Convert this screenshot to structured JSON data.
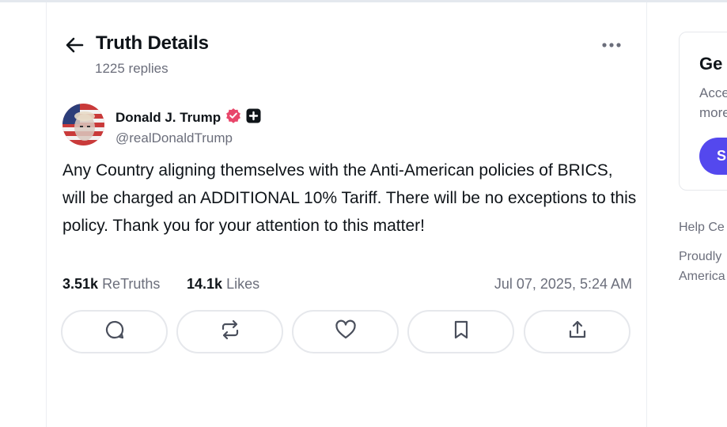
{
  "header": {
    "title": "Truth Details",
    "reply_count": "1225 replies"
  },
  "post": {
    "author_name": "Donald J. Trump",
    "author_handle": "@realDonaldTrump",
    "text": "Any Country aligning themselves with the Anti-American policies of BRICS, will be charged an ADDITIONAL 10% Tariff. There will be no exceptions to this policy. Thank you for your attention to this matter!",
    "retruths_count": "3.51k",
    "retruths_label": "ReTruths",
    "likes_count": "14.1k",
    "likes_label": "Likes",
    "timestamp": "Jul 07, 2025, 5:24 AM"
  },
  "actions": [
    {
      "icon": "reply-icon"
    },
    {
      "icon": "retruth-icon"
    },
    {
      "icon": "heart-icon"
    },
    {
      "icon": "bookmark-icon"
    },
    {
      "icon": "share-icon"
    }
  ],
  "sidebar": {
    "card_title": "Ge",
    "card_desc_line1": "Acce",
    "card_desc_line2": "more",
    "card_button": "S",
    "help_link": "Help Ce",
    "proudly_line1": "Proudly",
    "proudly_line2": "America"
  },
  "colors": {
    "verified_badge": "#e8466a",
    "accent_button": "#5448ee",
    "muted_text": "#6b6e7b",
    "border": "#e6e8ec"
  }
}
